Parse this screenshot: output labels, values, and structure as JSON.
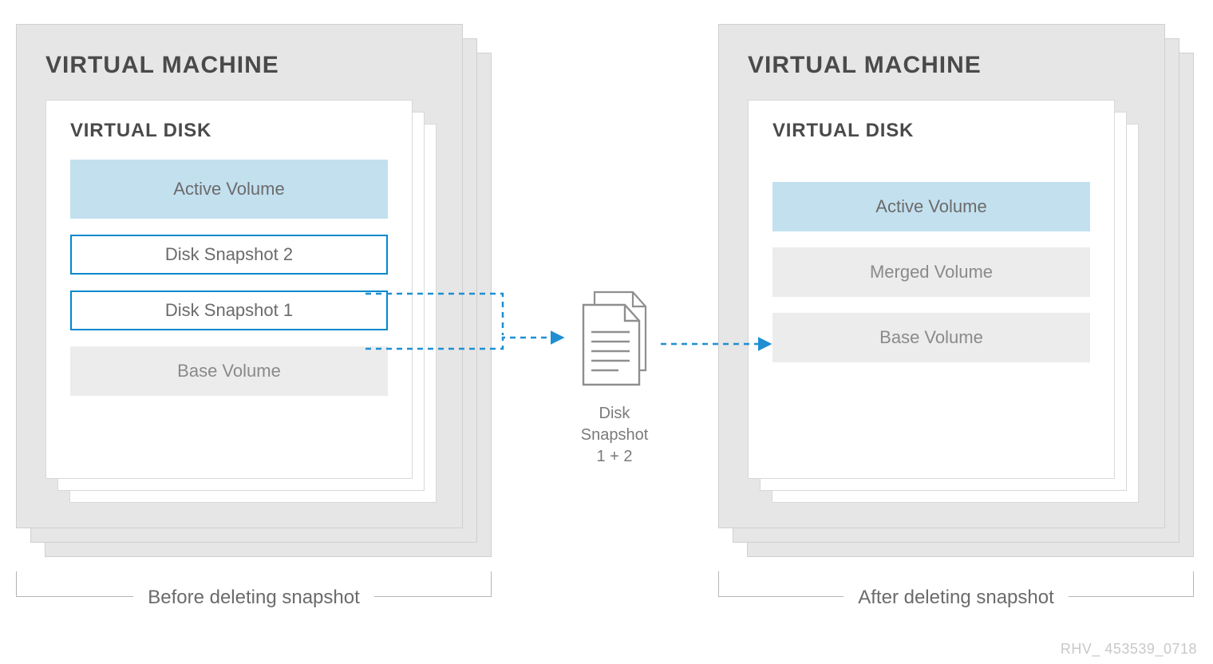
{
  "left": {
    "vm_title": "VIRTUAL MACHINE",
    "disk_title": "VIRTUAL DISK",
    "volumes": {
      "active": "Active Volume",
      "snapshot2": "Disk Snapshot 2",
      "snapshot1": "Disk Snapshot 1",
      "base": "Base Volume"
    },
    "caption": "Before deleting snapshot"
  },
  "center": {
    "doc_label_line1": "Disk",
    "doc_label_line2": "Snapshot",
    "doc_label_line3": "1 + 2"
  },
  "right": {
    "vm_title": "VIRTUAL MACHINE",
    "disk_title": "VIRTUAL DISK",
    "volumes": {
      "active": "Active Volume",
      "merged": "Merged Volume",
      "base": "Base Volume"
    },
    "caption": "After deleting snapshot"
  },
  "footer_id": "RHV_ 453539_0718"
}
